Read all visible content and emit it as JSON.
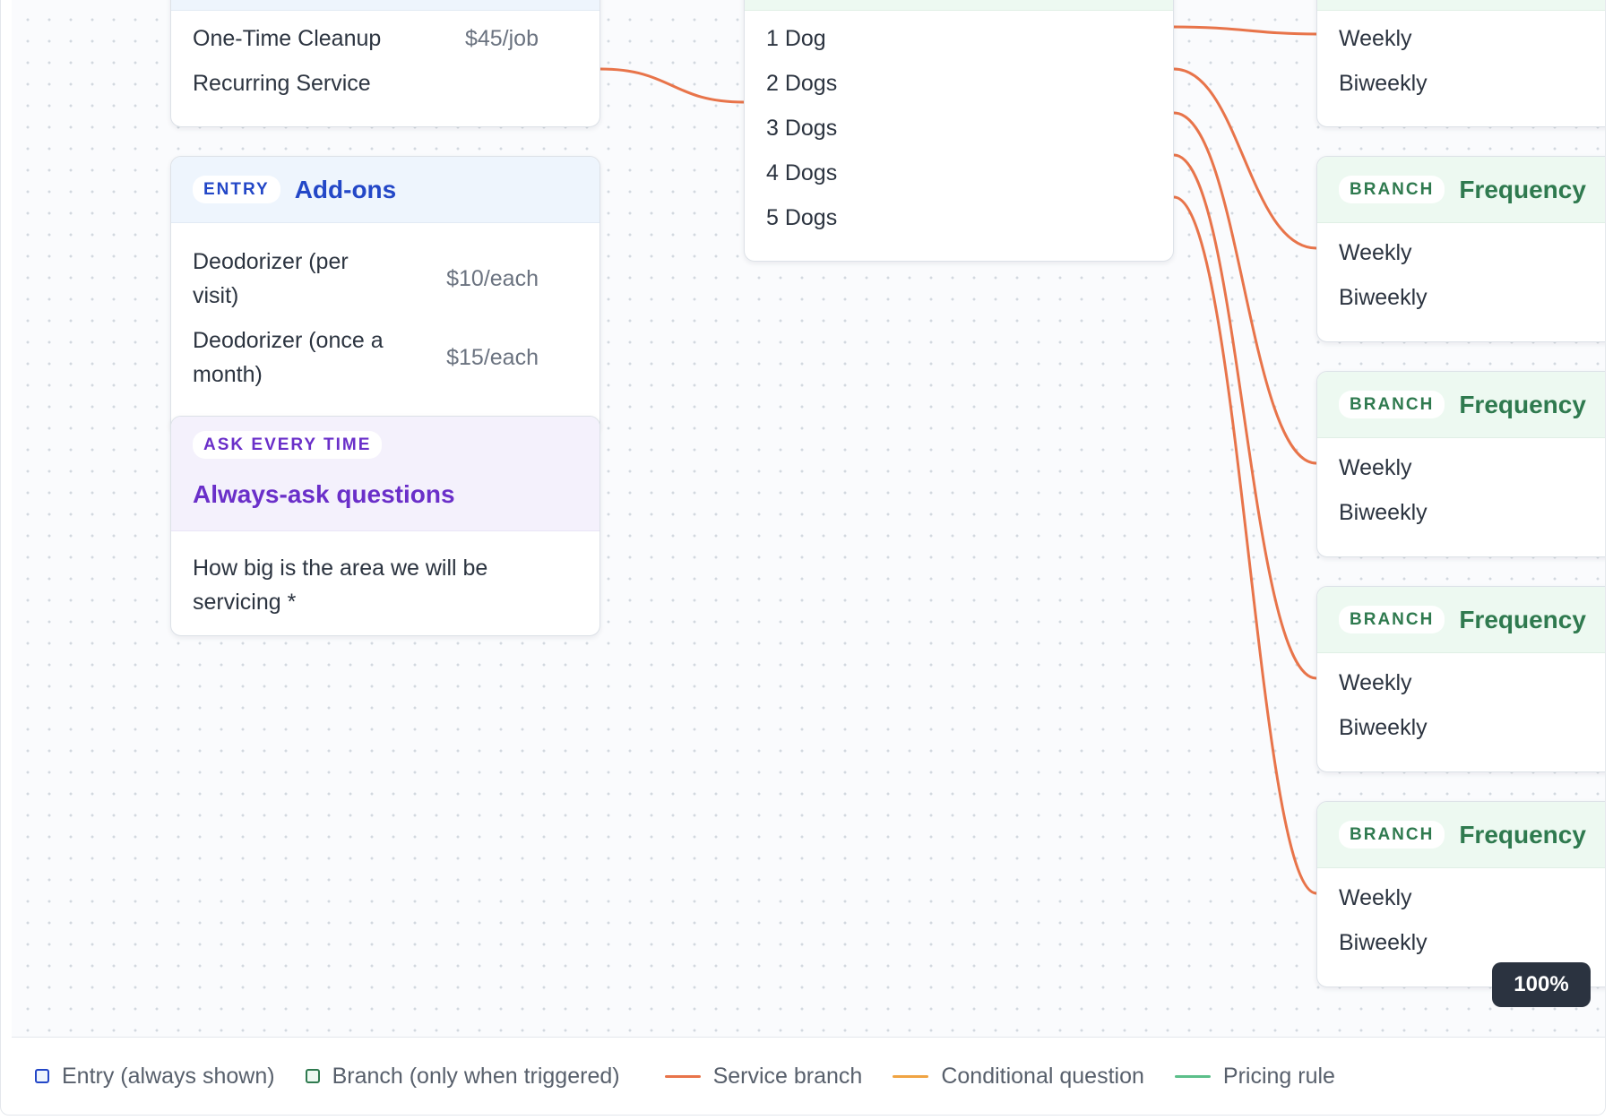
{
  "entry_service": {
    "options": [
      {
        "label": "One-Time Cleanup",
        "price": "$45/job"
      },
      {
        "label": "Recurring Service",
        "price": ""
      }
    ]
  },
  "entry_addons": {
    "badge": "ENTRY",
    "title": "Add-ons",
    "options": [
      {
        "label": "Deodorizer (per visit)",
        "price": "$10/each"
      },
      {
        "label": "Deodorizer (once a month)",
        "price": "$15/each"
      }
    ]
  },
  "ask_every_time": {
    "badge": "ASK EVERY TIME",
    "title": "Always-ask questions",
    "question": "How big is the area we will be servicing *"
  },
  "dogs_branch": {
    "options": [
      "1 Dog",
      "2 Dogs",
      "3 Dogs",
      "4 Dogs",
      "5 Dogs"
    ]
  },
  "frequency_top": {
    "options": [
      "Weekly",
      "Biweekly"
    ]
  },
  "frequency_nodes": [
    {
      "badge": "BRANCH",
      "title": "Frequency",
      "options": [
        "Weekly",
        "Biweekly"
      ]
    },
    {
      "badge": "BRANCH",
      "title": "Frequency",
      "options": [
        "Weekly",
        "Biweekly"
      ]
    },
    {
      "badge": "BRANCH",
      "title": "Frequency",
      "options": [
        "Weekly",
        "Biweekly"
      ]
    },
    {
      "badge": "BRANCH",
      "title": "Frequency",
      "options": [
        "Weekly",
        "Biweekly"
      ]
    }
  ],
  "zoom": "100%",
  "legend": {
    "entry": "Entry (always shown)",
    "branch": "Branch (only when triggered)",
    "service_branch": "Service branch",
    "conditional_question": "Conditional question",
    "pricing_rule": "Pricing rule"
  },
  "colors": {
    "entry": "#2347c7",
    "branch": "#2f7a4f",
    "ask": "#6a2fc9",
    "service_branch": "#e8744a",
    "conditional_question": "#f0a443",
    "pricing_rule": "#5cbf8a"
  }
}
